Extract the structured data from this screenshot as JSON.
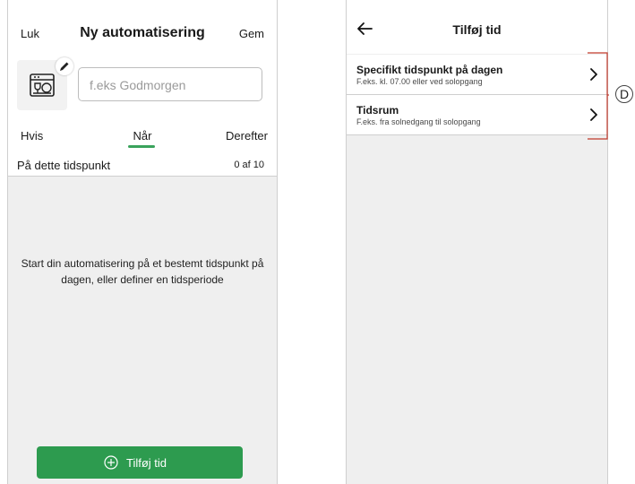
{
  "left_screen": {
    "header": {
      "close_label": "Luk",
      "title": "Ny automatisering",
      "save_label": "Gem"
    },
    "name_field": {
      "placeholder": "f.eks Godmorgen",
      "value": ""
    },
    "icon": "dishwasher-icon",
    "tabs": [
      {
        "label": "Hvis",
        "selected": false
      },
      {
        "label": "Når",
        "selected": true
      },
      {
        "label": "Derefter",
        "selected": false
      }
    ],
    "section": {
      "title": "På dette tidspunkt",
      "count": "0 af 10"
    },
    "empty_state": "Start din automatisering på et bestemt tidspunkt på dagen, eller definer en tidsperiode",
    "add_button": {
      "label": "Tilføj tid",
      "icon": "plus-circle-icon"
    },
    "accent_color": "#2d9b4f"
  },
  "right_screen": {
    "header": {
      "title": "Tilføj tid",
      "back_icon": "back-arrow-icon"
    },
    "items": [
      {
        "title": "Specifikt tidspunkt på dagen",
        "subtitle": "F.eks. kl. 07.00 eller ved solopgang"
      },
      {
        "title": "Tidsrum",
        "subtitle": "F.eks. fra solnedgang til solopgang"
      }
    ]
  },
  "annotation": {
    "label": "D"
  }
}
